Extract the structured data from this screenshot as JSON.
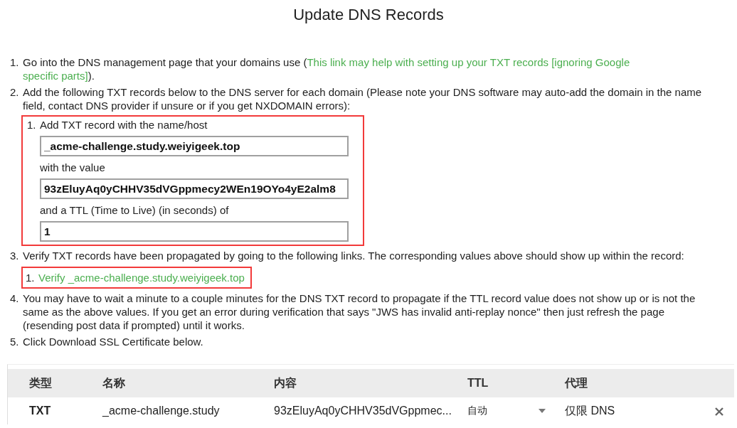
{
  "title": "Update DNS Records",
  "steps": [
    {
      "number": "1.",
      "kind": "link_text",
      "text_before": "Go into the DNS management page that your domains use (",
      "link_lines": [
        "This link may help with setting up your TXT records [ignoring Google",
        "specific parts]"
      ],
      "text_after": ")."
    },
    {
      "number": "2.",
      "kind": "record",
      "text": "Add the following TXT records below to the DNS server for each domain (Please note your DNS software may auto-add the domain in the name field, contact DNS provider if unsure or if you get NXDOMAIN errors):",
      "record": {
        "number": "1.",
        "highlighted": true,
        "name_label": "Add TXT record with the name/host",
        "name_value": "_acme-challenge.study.weiyigeek.top",
        "value_label": "with the value",
        "value": "93zEluyAq0yCHHV35dVGppmecy2WEn19OYo4yE2alm8",
        "ttl_label": "and a TTL (Time to Live) (in seconds) of",
        "ttl": "1"
      }
    },
    {
      "number": "3.",
      "kind": "verify",
      "text": "Verify TXT records have been propagated by going to the following links. The corresponding values above should show up within the record:",
      "links": [
        {
          "number": "1.",
          "label": "Verify _acme-challenge.study.weiyigeek.top",
          "highlighted": true
        }
      ]
    },
    {
      "number": "4.",
      "kind": "text",
      "text": "You may have to wait a minute to a couple minutes for the DNS TXT record to propagate if the TTL record value does not show up or is not the same as the above values. If you get an error during verification that says \"JWS has invalid anti-replay nonce\" then just refresh the page (resending post data if prompted) until it works."
    },
    {
      "number": "5.",
      "kind": "text",
      "text": "Click Download SSL Certificate below."
    }
  ],
  "table": {
    "columns": [
      "类型",
      "名称",
      "内容",
      "TTL",
      "代理"
    ],
    "rows": [
      {
        "type": "TXT",
        "name": "_acme-challenge.study",
        "content": "93zEluyAq0yCHHV35dVGppmec...",
        "ttl": "自动",
        "proxy": "仅限 DNS"
      }
    ]
  }
}
